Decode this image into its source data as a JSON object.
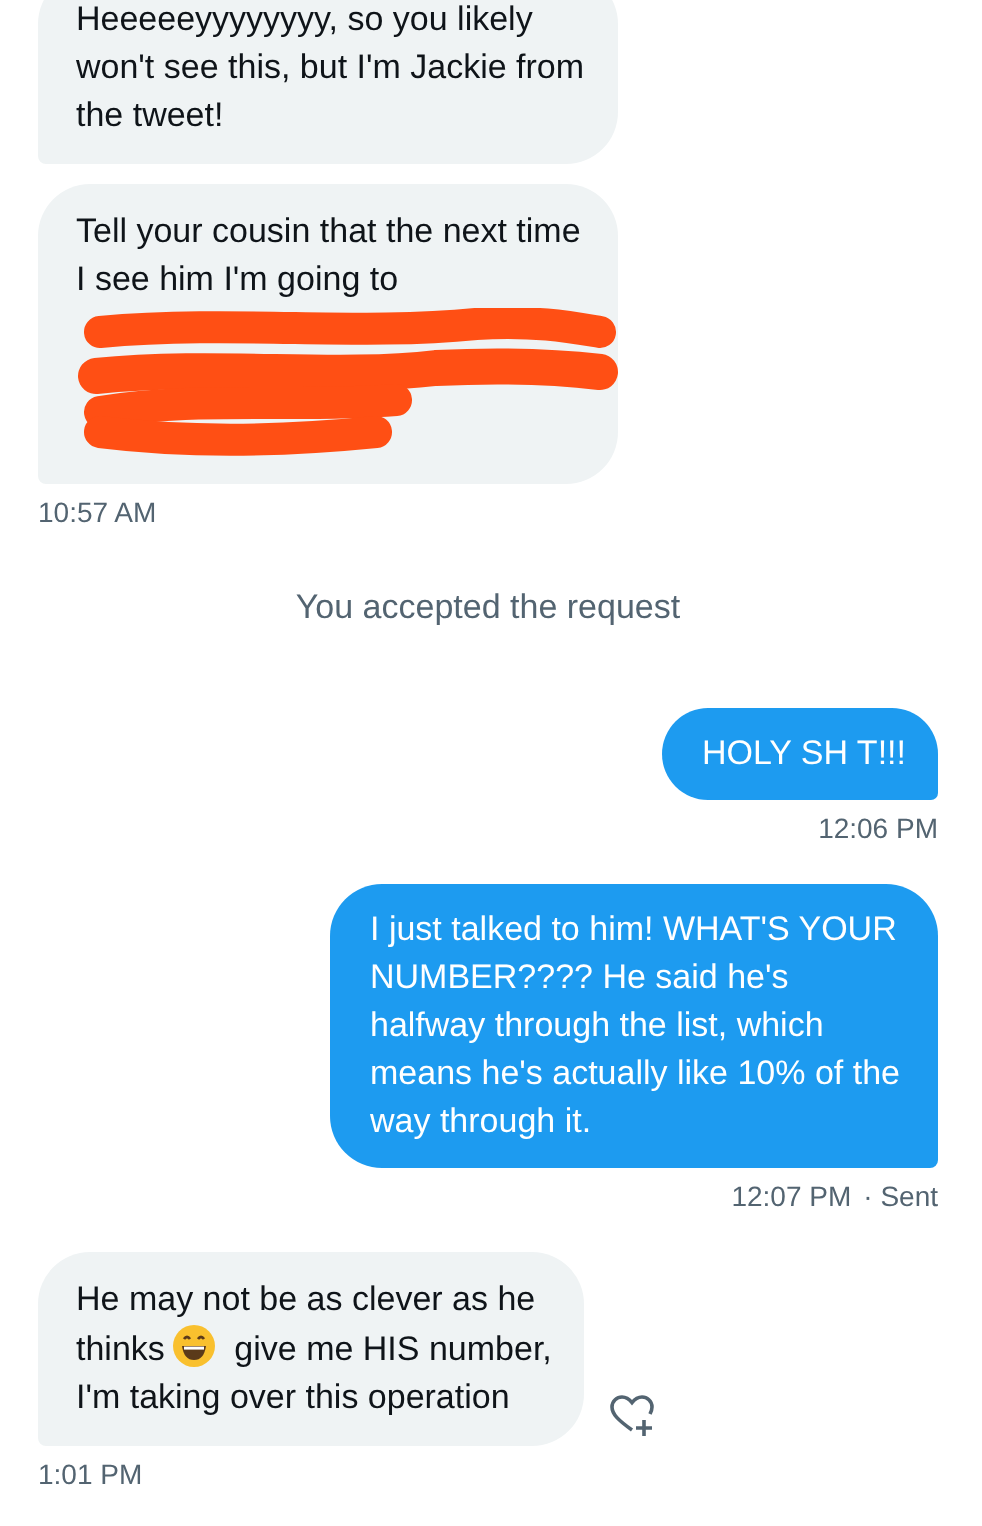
{
  "messages": [
    {
      "kind": "received",
      "parts": [
        {
          "kind": "text",
          "text": "Heeeeeyyyyyyyy, so you likely won't see this, but I'm Jackie from the tweet!"
        }
      ]
    },
    {
      "kind": "received",
      "parts": [
        {
          "kind": "text",
          "text": "Tell your cousin that the next time I see him I'm going to"
        },
        {
          "kind": "redaction"
        }
      ],
      "time": "10:57 AM"
    },
    {
      "kind": "system",
      "text": "You accepted the request"
    },
    {
      "kind": "sent",
      "parts": [
        {
          "kind": "text",
          "text": "HOLY SH T!!!"
        }
      ],
      "time": "12:06 PM"
    },
    {
      "kind": "sent",
      "parts": [
        {
          "kind": "text",
          "text": "I just talked to him! WHAT'S YOUR NUMBER???? He said he's halfway through the list, which means he's actually like 10% of the way through it."
        }
      ],
      "time": "12:07 PM",
      "status": "· Sent"
    },
    {
      "kind": "received",
      "parts": [
        {
          "kind": "line",
          "text": "He may not be as clever as he"
        },
        {
          "kind": "line-start",
          "text": "thinks"
        },
        {
          "kind": "emoji"
        },
        {
          "kind": "line-end",
          "text": "give me HIS number,"
        },
        {
          "kind": "line",
          "text": "I'm taking over this operation"
        }
      ],
      "time": "1:01 PM",
      "reaction_button": true
    }
  ]
}
